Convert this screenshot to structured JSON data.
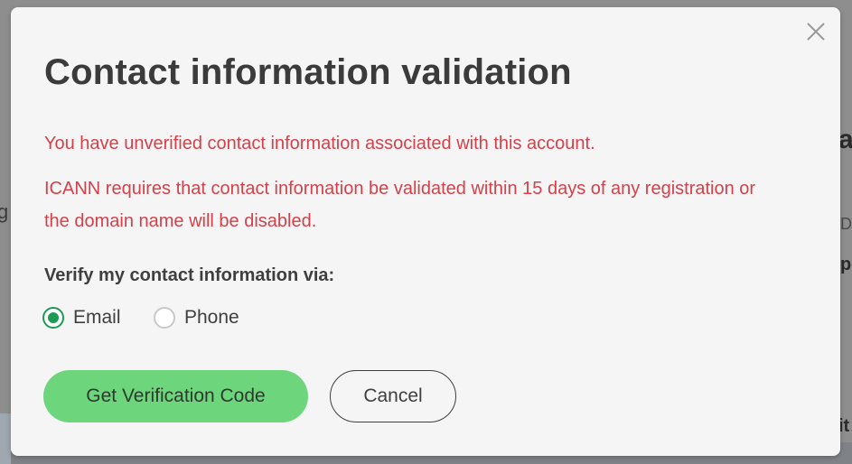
{
  "background": {
    "fragment_left": "g",
    "fragment_right_top": "a",
    "fragment_right_mid": "Do",
    "fragment_right_mid2": "p",
    "fragment_right_bottom": "it"
  },
  "modal": {
    "title": "Contact information validation",
    "close_icon": "close-x-icon",
    "warning_line_1": "You have unverified contact information associated with this account.",
    "warning_line_2": "ICANN requires that contact information be validated within 15 days of any registration or the domain name will be disabled.",
    "warning_color": "#d4414a",
    "verify_label": "Verify my contact information via:",
    "options": [
      {
        "label": "Email",
        "checked": true
      },
      {
        "label": "Phone",
        "checked": false
      }
    ],
    "accent_color": "#1c9b55",
    "primary_button": "Get Verification Code",
    "primary_button_color": "#6dd67c",
    "cancel_button": "Cancel"
  }
}
